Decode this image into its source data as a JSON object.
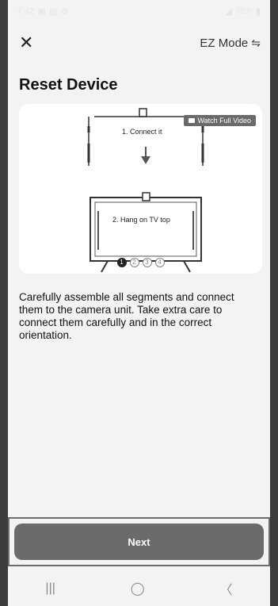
{
  "status": {
    "time": "7:42",
    "battery": "76%"
  },
  "nav": {
    "mode_label": "EZ Mode"
  },
  "page": {
    "title": "Reset Device"
  },
  "card": {
    "step1": "1. Connect it",
    "step2": "2. Hang on TV top",
    "video_label": "Watch Full Video",
    "pages": [
      "1",
      "2",
      "3",
      "4"
    ]
  },
  "description": "Carefully assemble all segments and connect them to the camera unit. Take extra care to connect them carefully and in the correct orientation.",
  "footer": {
    "next_label": "Next"
  }
}
